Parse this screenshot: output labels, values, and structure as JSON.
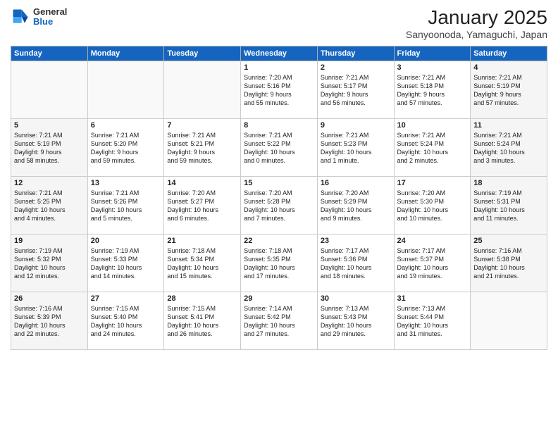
{
  "header": {
    "logo_line1": "General",
    "logo_line2": "Blue",
    "title": "January 2025",
    "subtitle": "Sanyoonoda, Yamaguchi, Japan"
  },
  "weekdays": [
    "Sunday",
    "Monday",
    "Tuesday",
    "Wednesday",
    "Thursday",
    "Friday",
    "Saturday"
  ],
  "weeks": [
    [
      {
        "day": "",
        "text": "",
        "weekend": true,
        "empty": true
      },
      {
        "day": "",
        "text": "",
        "weekend": false,
        "empty": true
      },
      {
        "day": "",
        "text": "",
        "weekend": false,
        "empty": true
      },
      {
        "day": "1",
        "text": "Sunrise: 7:20 AM\nSunset: 5:16 PM\nDaylight: 9 hours\nand 55 minutes.",
        "weekend": false,
        "empty": false
      },
      {
        "day": "2",
        "text": "Sunrise: 7:21 AM\nSunset: 5:17 PM\nDaylight: 9 hours\nand 56 minutes.",
        "weekend": false,
        "empty": false
      },
      {
        "day": "3",
        "text": "Sunrise: 7:21 AM\nSunset: 5:18 PM\nDaylight: 9 hours\nand 57 minutes.",
        "weekend": false,
        "empty": false
      },
      {
        "day": "4",
        "text": "Sunrise: 7:21 AM\nSunset: 5:19 PM\nDaylight: 9 hours\nand 57 minutes.",
        "weekend": true,
        "empty": false
      }
    ],
    [
      {
        "day": "5",
        "text": "Sunrise: 7:21 AM\nSunset: 5:19 PM\nDaylight: 9 hours\nand 58 minutes.",
        "weekend": true,
        "empty": false
      },
      {
        "day": "6",
        "text": "Sunrise: 7:21 AM\nSunset: 5:20 PM\nDaylight: 9 hours\nand 59 minutes.",
        "weekend": false,
        "empty": false
      },
      {
        "day": "7",
        "text": "Sunrise: 7:21 AM\nSunset: 5:21 PM\nDaylight: 9 hours\nand 59 minutes.",
        "weekend": false,
        "empty": false
      },
      {
        "day": "8",
        "text": "Sunrise: 7:21 AM\nSunset: 5:22 PM\nDaylight: 10 hours\nand 0 minutes.",
        "weekend": false,
        "empty": false
      },
      {
        "day": "9",
        "text": "Sunrise: 7:21 AM\nSunset: 5:23 PM\nDaylight: 10 hours\nand 1 minute.",
        "weekend": false,
        "empty": false
      },
      {
        "day": "10",
        "text": "Sunrise: 7:21 AM\nSunset: 5:24 PM\nDaylight: 10 hours\nand 2 minutes.",
        "weekend": false,
        "empty": false
      },
      {
        "day": "11",
        "text": "Sunrise: 7:21 AM\nSunset: 5:24 PM\nDaylight: 10 hours\nand 3 minutes.",
        "weekend": true,
        "empty": false
      }
    ],
    [
      {
        "day": "12",
        "text": "Sunrise: 7:21 AM\nSunset: 5:25 PM\nDaylight: 10 hours\nand 4 minutes.",
        "weekend": true,
        "empty": false
      },
      {
        "day": "13",
        "text": "Sunrise: 7:21 AM\nSunset: 5:26 PM\nDaylight: 10 hours\nand 5 minutes.",
        "weekend": false,
        "empty": false
      },
      {
        "day": "14",
        "text": "Sunrise: 7:20 AM\nSunset: 5:27 PM\nDaylight: 10 hours\nand 6 minutes.",
        "weekend": false,
        "empty": false
      },
      {
        "day": "15",
        "text": "Sunrise: 7:20 AM\nSunset: 5:28 PM\nDaylight: 10 hours\nand 7 minutes.",
        "weekend": false,
        "empty": false
      },
      {
        "day": "16",
        "text": "Sunrise: 7:20 AM\nSunset: 5:29 PM\nDaylight: 10 hours\nand 9 minutes.",
        "weekend": false,
        "empty": false
      },
      {
        "day": "17",
        "text": "Sunrise: 7:20 AM\nSunset: 5:30 PM\nDaylight: 10 hours\nand 10 minutes.",
        "weekend": false,
        "empty": false
      },
      {
        "day": "18",
        "text": "Sunrise: 7:19 AM\nSunset: 5:31 PM\nDaylight: 10 hours\nand 11 minutes.",
        "weekend": true,
        "empty": false
      }
    ],
    [
      {
        "day": "19",
        "text": "Sunrise: 7:19 AM\nSunset: 5:32 PM\nDaylight: 10 hours\nand 12 minutes.",
        "weekend": true,
        "empty": false
      },
      {
        "day": "20",
        "text": "Sunrise: 7:19 AM\nSunset: 5:33 PM\nDaylight: 10 hours\nand 14 minutes.",
        "weekend": false,
        "empty": false
      },
      {
        "day": "21",
        "text": "Sunrise: 7:18 AM\nSunset: 5:34 PM\nDaylight: 10 hours\nand 15 minutes.",
        "weekend": false,
        "empty": false
      },
      {
        "day": "22",
        "text": "Sunrise: 7:18 AM\nSunset: 5:35 PM\nDaylight: 10 hours\nand 17 minutes.",
        "weekend": false,
        "empty": false
      },
      {
        "day": "23",
        "text": "Sunrise: 7:17 AM\nSunset: 5:36 PM\nDaylight: 10 hours\nand 18 minutes.",
        "weekend": false,
        "empty": false
      },
      {
        "day": "24",
        "text": "Sunrise: 7:17 AM\nSunset: 5:37 PM\nDaylight: 10 hours\nand 19 minutes.",
        "weekend": false,
        "empty": false
      },
      {
        "day": "25",
        "text": "Sunrise: 7:16 AM\nSunset: 5:38 PM\nDaylight: 10 hours\nand 21 minutes.",
        "weekend": true,
        "empty": false
      }
    ],
    [
      {
        "day": "26",
        "text": "Sunrise: 7:16 AM\nSunset: 5:39 PM\nDaylight: 10 hours\nand 22 minutes.",
        "weekend": true,
        "empty": false
      },
      {
        "day": "27",
        "text": "Sunrise: 7:15 AM\nSunset: 5:40 PM\nDaylight: 10 hours\nand 24 minutes.",
        "weekend": false,
        "empty": false
      },
      {
        "day": "28",
        "text": "Sunrise: 7:15 AM\nSunset: 5:41 PM\nDaylight: 10 hours\nand 26 minutes.",
        "weekend": false,
        "empty": false
      },
      {
        "day": "29",
        "text": "Sunrise: 7:14 AM\nSunset: 5:42 PM\nDaylight: 10 hours\nand 27 minutes.",
        "weekend": false,
        "empty": false
      },
      {
        "day": "30",
        "text": "Sunrise: 7:13 AM\nSunset: 5:43 PM\nDaylight: 10 hours\nand 29 minutes.",
        "weekend": false,
        "empty": false
      },
      {
        "day": "31",
        "text": "Sunrise: 7:13 AM\nSunset: 5:44 PM\nDaylight: 10 hours\nand 31 minutes.",
        "weekend": false,
        "empty": false
      },
      {
        "day": "",
        "text": "",
        "weekend": true,
        "empty": true
      }
    ]
  ]
}
